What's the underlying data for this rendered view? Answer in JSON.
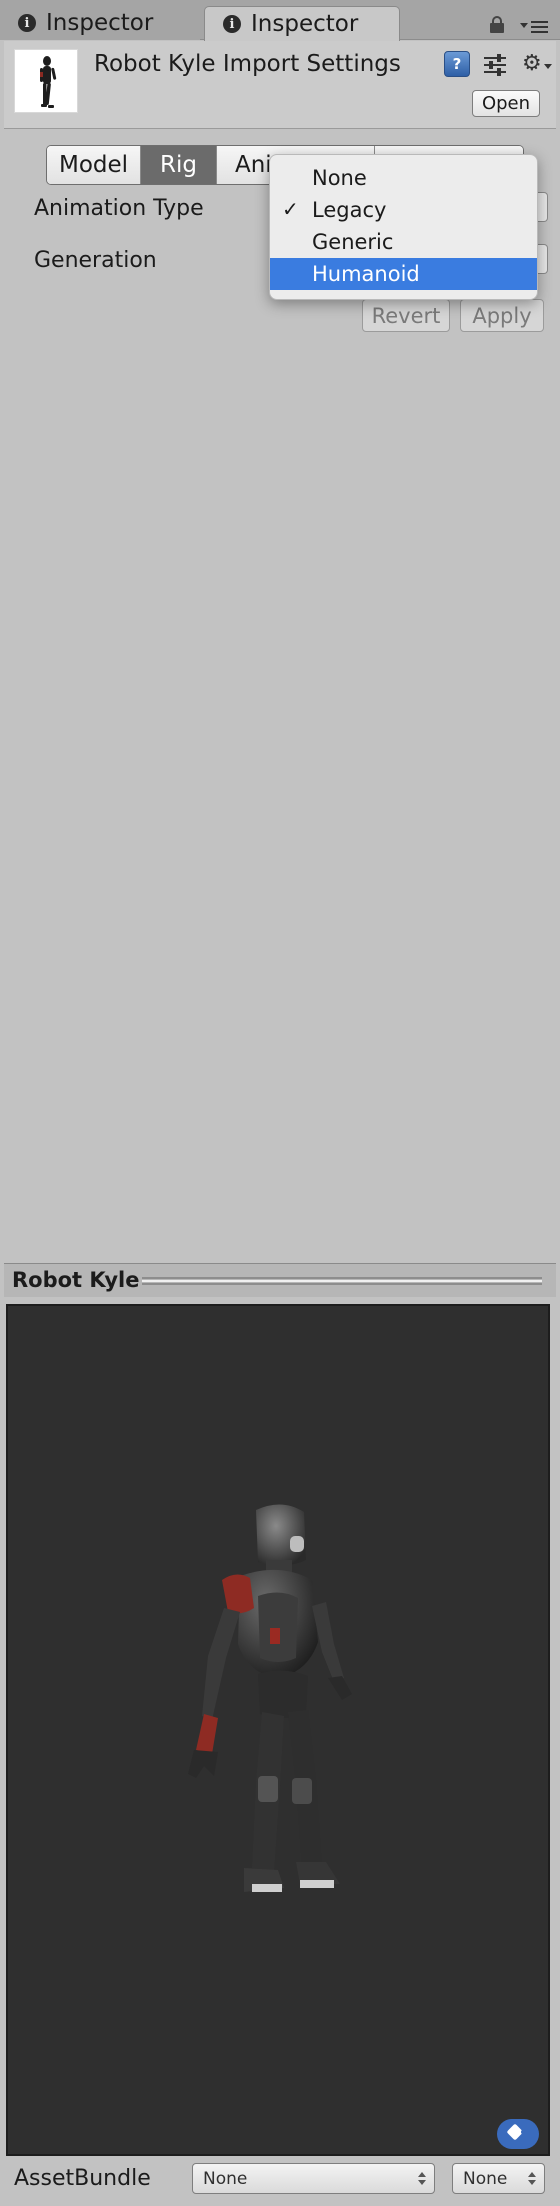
{
  "tabs": [
    {
      "label": "Inspector",
      "icon": "info-icon",
      "active": false
    },
    {
      "label": "Inspector",
      "icon": "info-icon",
      "active": true
    }
  ],
  "header": {
    "title": "Robot Kyle Import Settings",
    "open_label": "Open",
    "icons": [
      "help-icon",
      "presets-icon",
      "gear-icon"
    ]
  },
  "segmented_tabs": [
    {
      "label": "Model",
      "selected": false
    },
    {
      "label": "Rig",
      "selected": true
    },
    {
      "label": "Ani",
      "selected": false
    },
    {
      "label": "",
      "selected": false
    }
  ],
  "properties": {
    "animation_type_label": "Animation Type",
    "generation_label": "Generation"
  },
  "buttons": {
    "revert": "Revert",
    "apply": "Apply"
  },
  "dropdown": {
    "options": [
      "None",
      "Legacy",
      "Generic",
      "Humanoid"
    ],
    "checked": "Legacy",
    "highlighted": "Humanoid",
    "check_glyph": "✓"
  },
  "preview": {
    "title": "Robot Kyle"
  },
  "asset_bundle": {
    "label": "AssetBundle",
    "name_value": "None",
    "variant_value": "None"
  },
  "colors": {
    "accent": "#3a7ce0",
    "selected_tab": "#6b6b6b",
    "viewport_bg": "#2f2f2f"
  }
}
